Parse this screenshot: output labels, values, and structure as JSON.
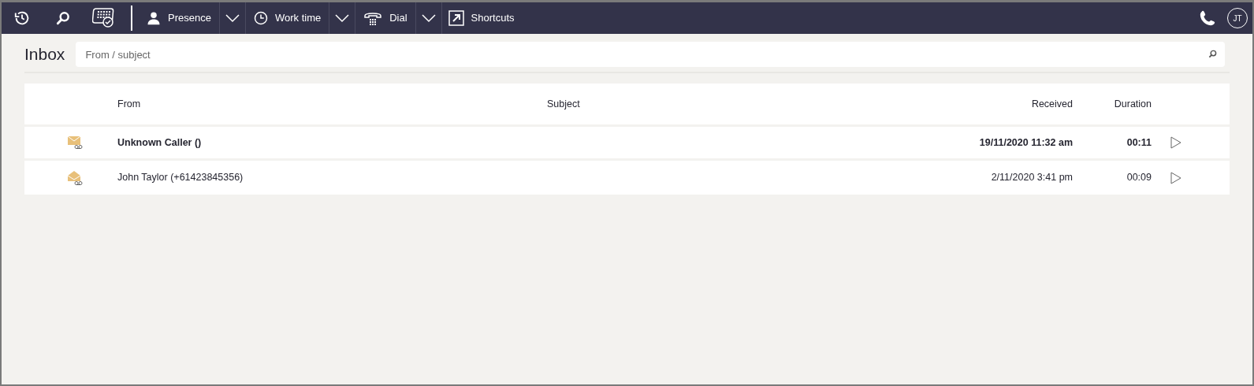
{
  "toolbar": {
    "items": [
      {
        "kind": "icon"
      },
      {
        "kind": "icon"
      },
      {
        "kind": "icon"
      },
      {
        "kind": "menu",
        "label": "Presence"
      },
      {
        "kind": "menu",
        "label": "Work time"
      },
      {
        "kind": "menu",
        "label": "Dial"
      },
      {
        "kind": "link",
        "label": "Shortcuts"
      }
    ],
    "avatar": "JT"
  },
  "page": {
    "title": "Inbox",
    "search": {
      "placeholder": "From / subject"
    }
  },
  "table": {
    "columns": [
      "From",
      "Subject",
      "Received",
      "Duration"
    ],
    "rows": [
      {
        "from": "Unknown Caller ()",
        "received": "19/11/2020 11:32 am",
        "duration": "00:11",
        "unread": true
      },
      {
        "from": "John Taylor (+61423845356)",
        "received": "2/11/2020 3:41 pm",
        "duration": "00:09",
        "unread": false
      }
    ]
  }
}
